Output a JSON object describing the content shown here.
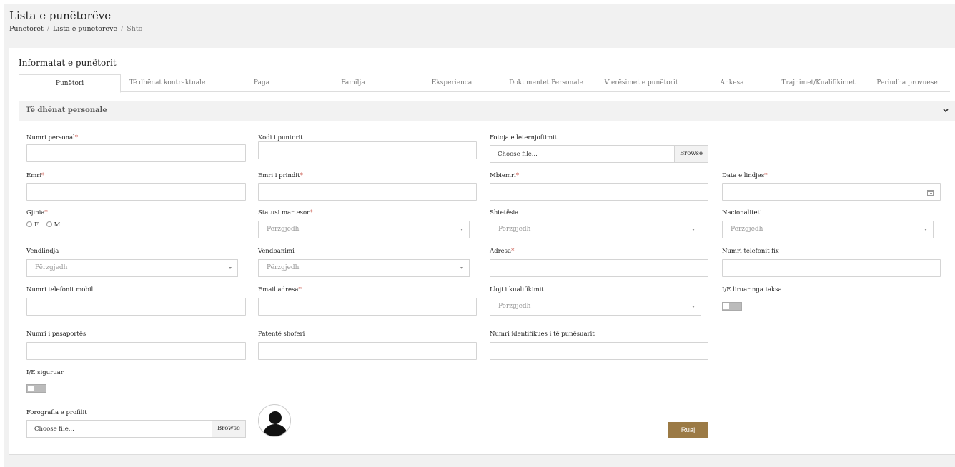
{
  "page": {
    "title": "Lista e punëtorëve",
    "breadcrumb": [
      "Punëtorët",
      "Lista e punëtorëve",
      "Shto"
    ]
  },
  "card": {
    "title": "Informatat e punëtorit",
    "tabs": [
      "Punëtori",
      "Të dhënat kontraktuale",
      "Paga",
      "Familja",
      "Eksperienca",
      "Dokumentet Personale",
      "Vlerësimet e punëtorit",
      "Ankesa",
      "Trajnimet/Kualifikimet",
      "Periudha provuese"
    ],
    "active_tab": "Punëtori",
    "section_title": "Të dhënat personale"
  },
  "form": {
    "required_mark": "*",
    "numri_personal": "Numri personal",
    "kodi_puntorit": "Kodi i puntorit",
    "fotoja": "Fotoja e leternjoftimit",
    "emri": "Emri",
    "emri_prindit": "Emri i prindit",
    "mbiemri": "Mbiemri",
    "data_lindjes": "Data e lindjes",
    "gjinia": "Gjinia",
    "gjinia_f": "F",
    "gjinia_m": "M",
    "statusi_martesor": "Statusi martesor",
    "shtetesia": "Shtetësia",
    "nacionaliteti": "Nacionaliteti",
    "vendlindja": "Vendlindja",
    "vendbanimi": "Vendbanimi",
    "adresa": "Adresa",
    "telefon_fix": "Numri telefonit fix",
    "telefon_mobil": "Numri telefonit mobil",
    "email": "Email adresa",
    "lloji_kualifikimit": "Lloji i kualifikimit",
    "liruar_taksa": "I/E liruar nga taksa",
    "pasaporta": "Numri i pasaportës",
    "patente": "Patentë shoferi",
    "numri_identifikues": "Numri identifikues i të punësuarit",
    "siguruar": "I/E siguruar",
    "fotografia_profilit": "Forografia e profilit",
    "select_placeholder": "Përzgjedh",
    "file_placeholder": "Choose file...",
    "browse_label": "Browse",
    "save_label": "Ruaj"
  },
  "colors": {
    "accent": "#9b7a45",
    "required": "#c0392b"
  },
  "icons": {
    "section_toggle": "chevron-down-icon",
    "date_picker": "calendar-icon",
    "avatar": "user-silhouette-icon"
  }
}
